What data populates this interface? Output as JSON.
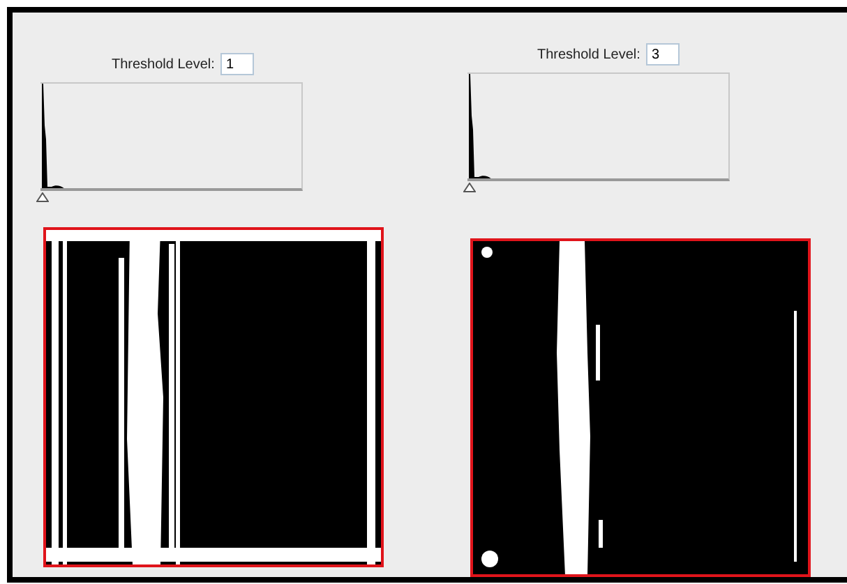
{
  "panels": [
    {
      "label": "Threshold Level:",
      "value": "1"
    },
    {
      "label": "Threshold Level:",
      "value": "3"
    }
  ]
}
